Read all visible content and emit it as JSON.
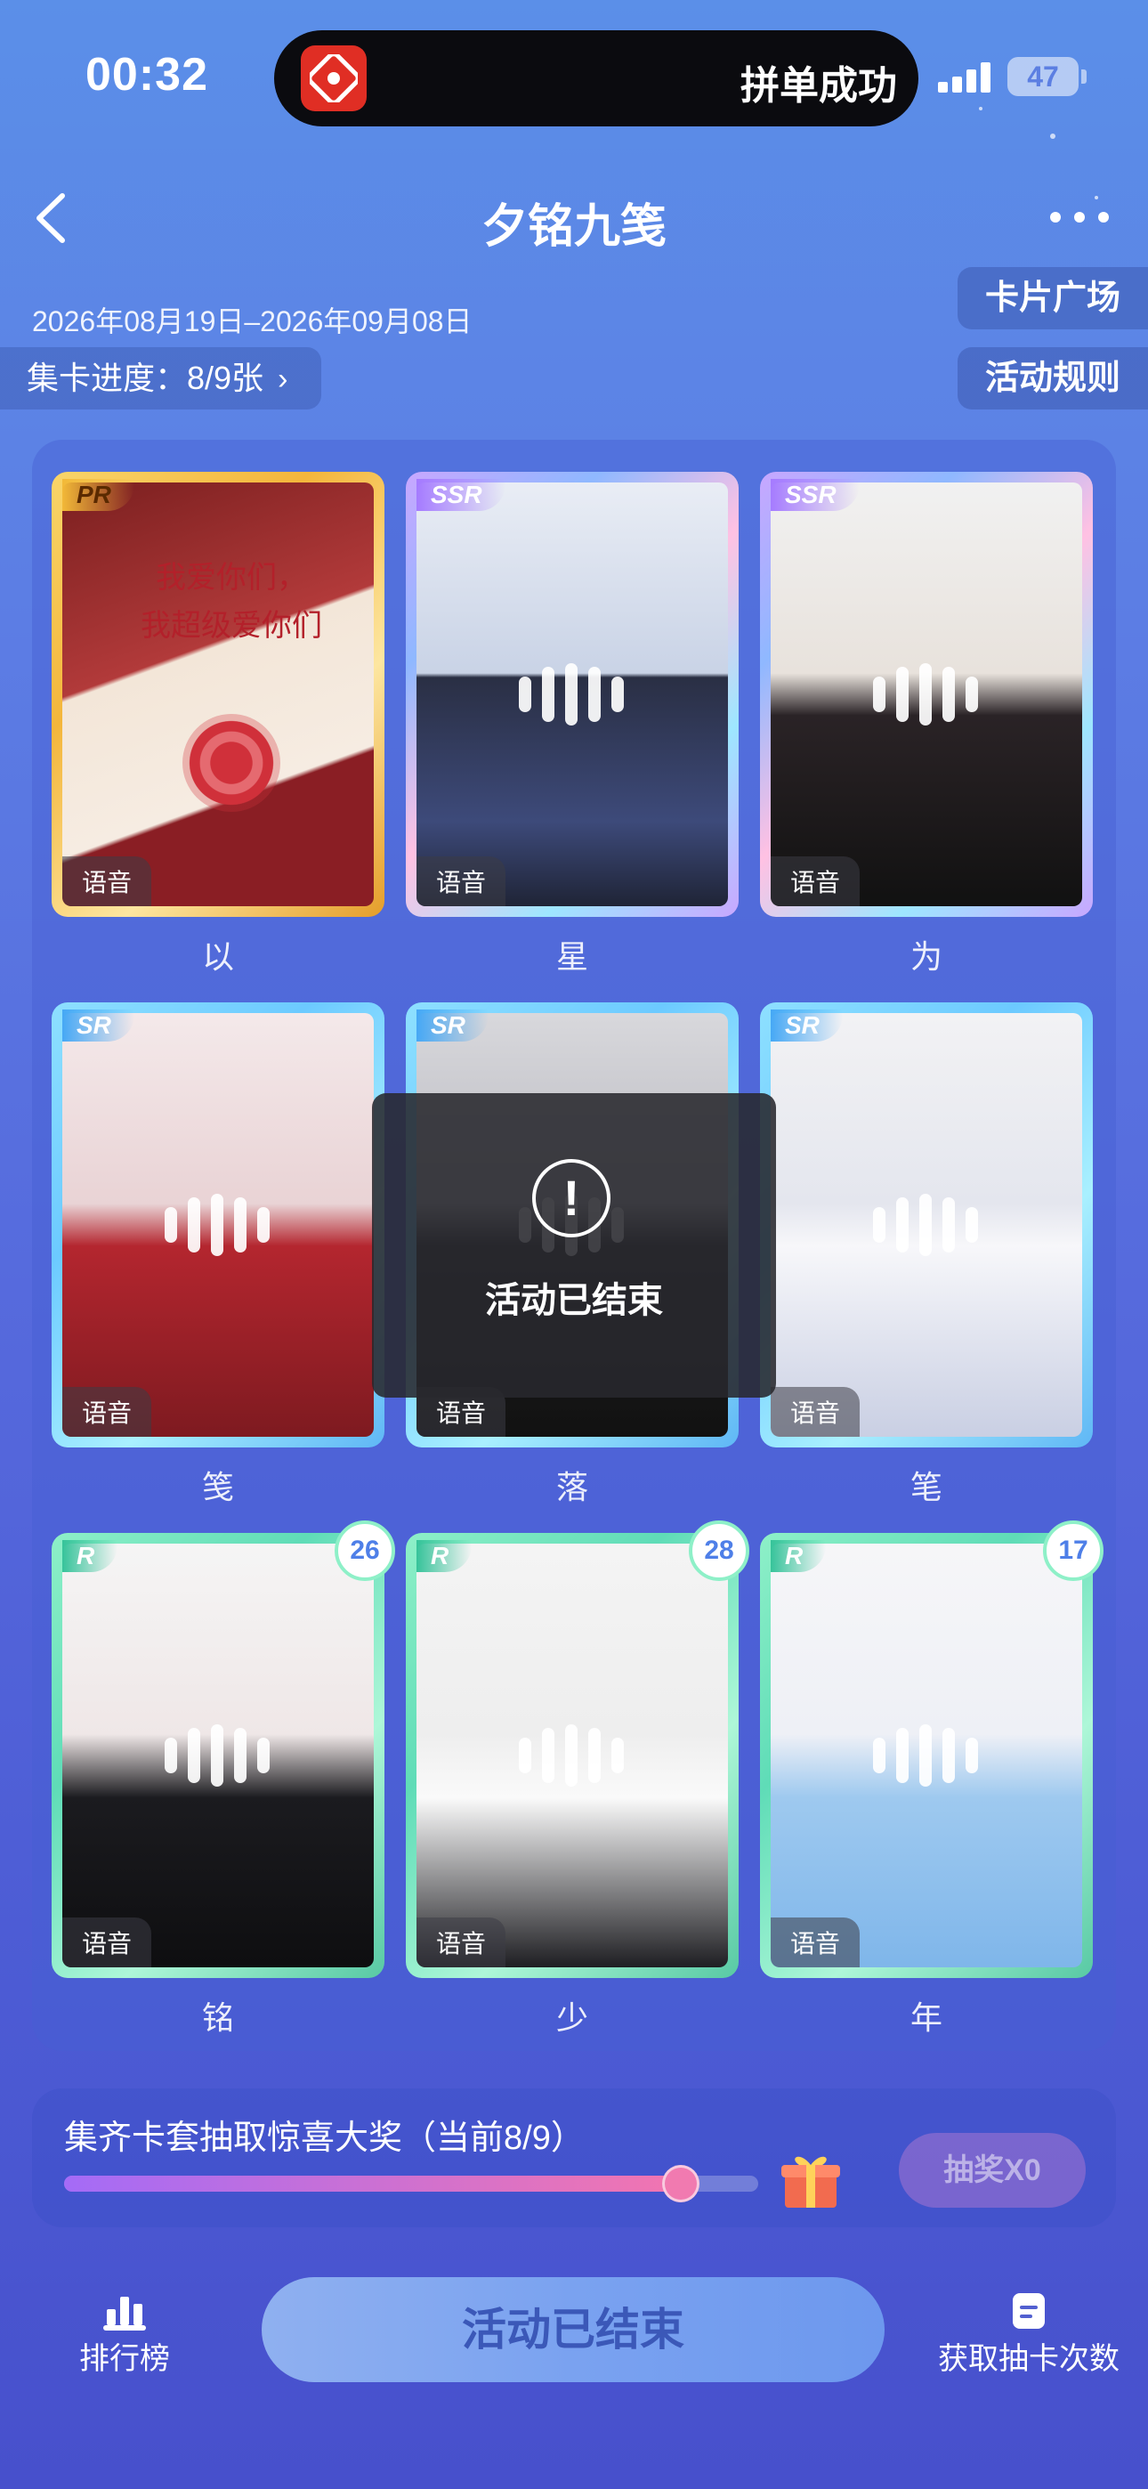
{
  "status": {
    "time": "00:32",
    "notification_text": "拼单成功",
    "battery": "47"
  },
  "nav": {
    "title": "夕铭九笺"
  },
  "header": {
    "date_range": "2026年08月19日–2026年09月08日",
    "progress_label": "集卡进度：8/9张",
    "card_plaza": "卡片广场",
    "rules": "活动规则"
  },
  "cards": [
    {
      "rarity": "PR",
      "caption": "以",
      "voice": "语音",
      "count": ""
    },
    {
      "rarity": "SSR",
      "caption": "星",
      "voice": "语音",
      "count": ""
    },
    {
      "rarity": "SSR",
      "caption": "为",
      "voice": "语音",
      "count": ""
    },
    {
      "rarity": "SR",
      "caption": "笺",
      "voice": "语音",
      "count": ""
    },
    {
      "rarity": "SR",
      "caption": "落",
      "voice": "语音",
      "count": ""
    },
    {
      "rarity": "SR",
      "caption": "笔",
      "voice": "语音",
      "count": ""
    },
    {
      "rarity": "R",
      "caption": "铭",
      "voice": "语音",
      "count": "26"
    },
    {
      "rarity": "R",
      "caption": "少",
      "voice": "语音",
      "count": "28"
    },
    {
      "rarity": "R",
      "caption": "年",
      "voice": "语音",
      "count": "17"
    }
  ],
  "pr_card_text": {
    "line1": "我爱你们，",
    "line2": "我超级爱你们"
  },
  "toast": {
    "icon": "!",
    "message": "活动已结束"
  },
  "reward": {
    "label": "集齐卡套抽取惊喜大奖（当前8/9）",
    "progress": 0.889,
    "draw_button": "抽奖X0"
  },
  "bottom": {
    "leaderboard": "排行榜",
    "main_button": "活动已结束",
    "get_draws": "获取抽卡次数"
  },
  "colors": {
    "accent": "#5b8fe8",
    "pr": "#f4b63b",
    "ssr": "#a57bff",
    "sr": "#46a8f5",
    "r": "#36c39a"
  }
}
